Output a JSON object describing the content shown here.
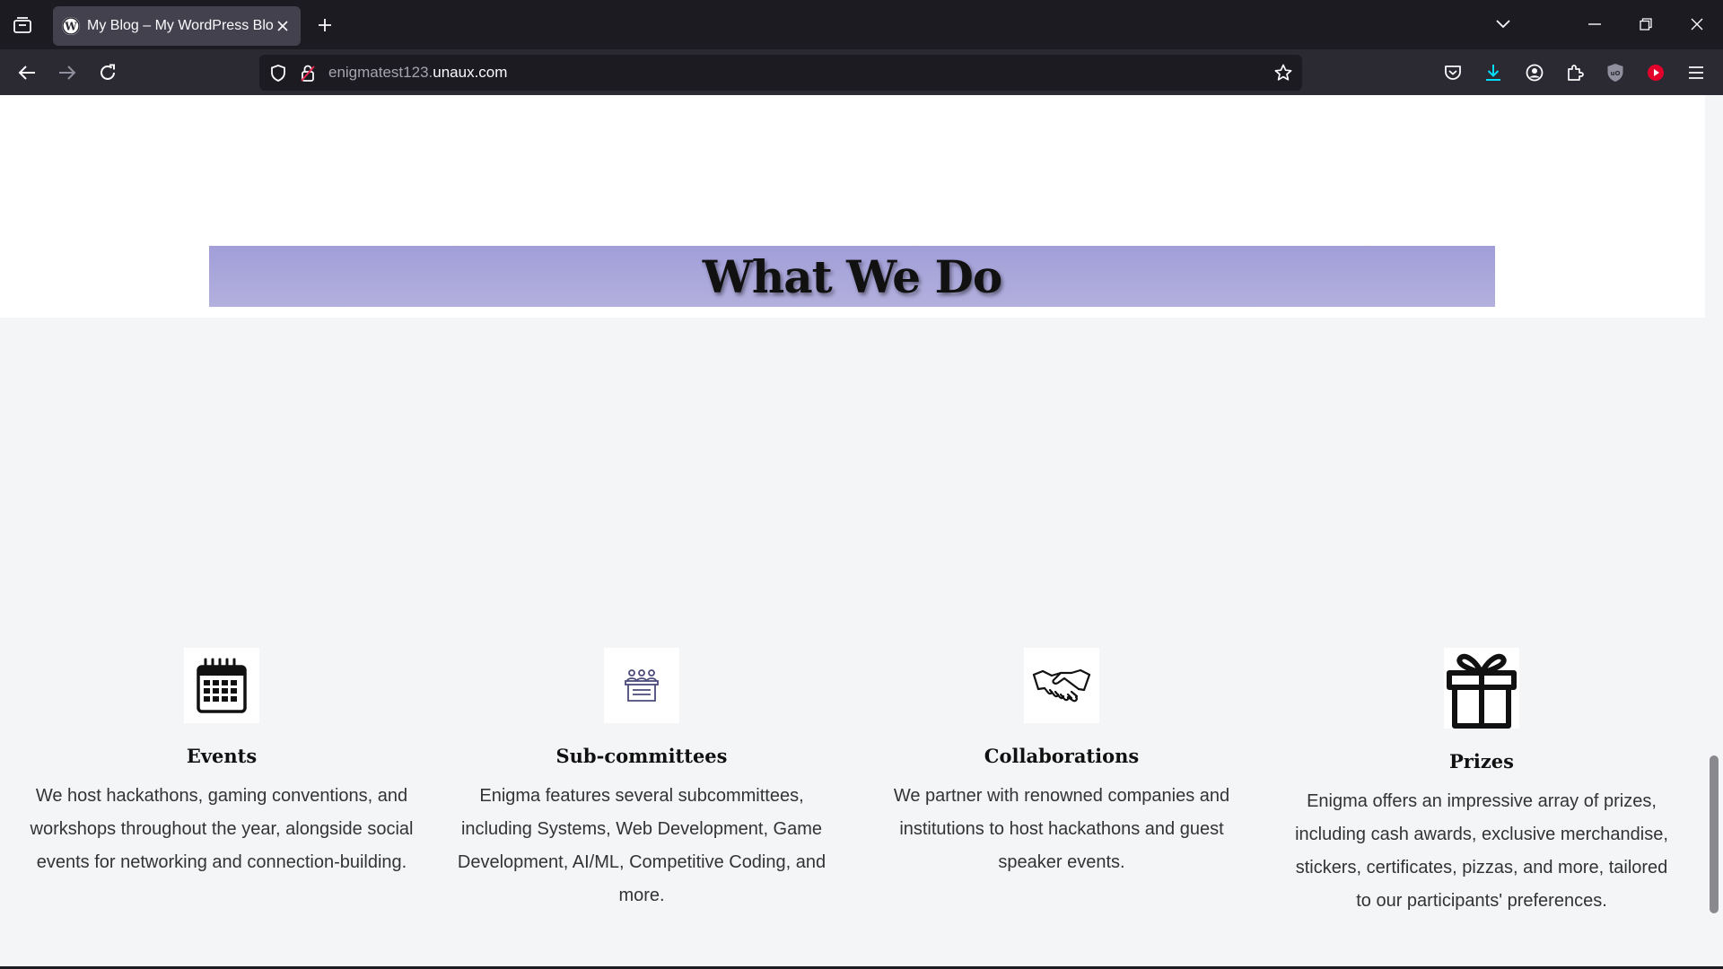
{
  "browser": {
    "tab": {
      "title": "My Blog – My WordPress Blog",
      "favicon": "wordpress-icon"
    },
    "url": {
      "subdomain": "enigmatest123.",
      "domain": "unaux.com"
    },
    "icons": {
      "tab_list": "tab-list-icon",
      "new_tab": "plus-icon",
      "list_all_tabs": "chevron-down-icon",
      "minimize": "minimize-icon",
      "restore": "restore-icon",
      "close": "close-icon",
      "back": "back-arrow-icon",
      "forward": "forward-arrow-icon",
      "reload": "reload-icon",
      "shield": "shield-icon",
      "insecure_lock": "insecure-lock-icon",
      "bookmark": "star-icon",
      "pocket": "pocket-icon",
      "downloads": "download-icon",
      "account": "account-icon",
      "extensions": "puzzle-icon",
      "ublock": "ublock-icon",
      "youtube_ext": "youtube-icon",
      "menu": "hamburger-icon"
    }
  },
  "page": {
    "section_heading": "What We Do",
    "colors": {
      "heading_bar_top": "#a19ed9",
      "heading_bar_bottom": "#b3b0dd",
      "section_background": "#f4f5f7"
    },
    "cards": [
      {
        "icon": "calendar-icon",
        "title": "Events",
        "text": "We host hackathons, gaming conventions, and workshops throughout the year, alongside social events for networking and connection-building."
      },
      {
        "icon": "committee-icon",
        "title": "Sub-committees",
        "text": "Enigma features several subcommittees, including Systems, Web Development, Game Development, AI/ML, Competitive Coding, and more."
      },
      {
        "icon": "handshake-icon",
        "title": "Collaborations",
        "text": "We partner with renowned companies and institutions to host hackathons and guest speaker events."
      },
      {
        "icon": "gift-icon",
        "title": "Prizes",
        "text": "Enigma offers an impressive array of prizes, including cash awards, exclusive merchandise, stickers, certificates, pizzas, and more, tailored to our participants' preferences."
      }
    ]
  }
}
